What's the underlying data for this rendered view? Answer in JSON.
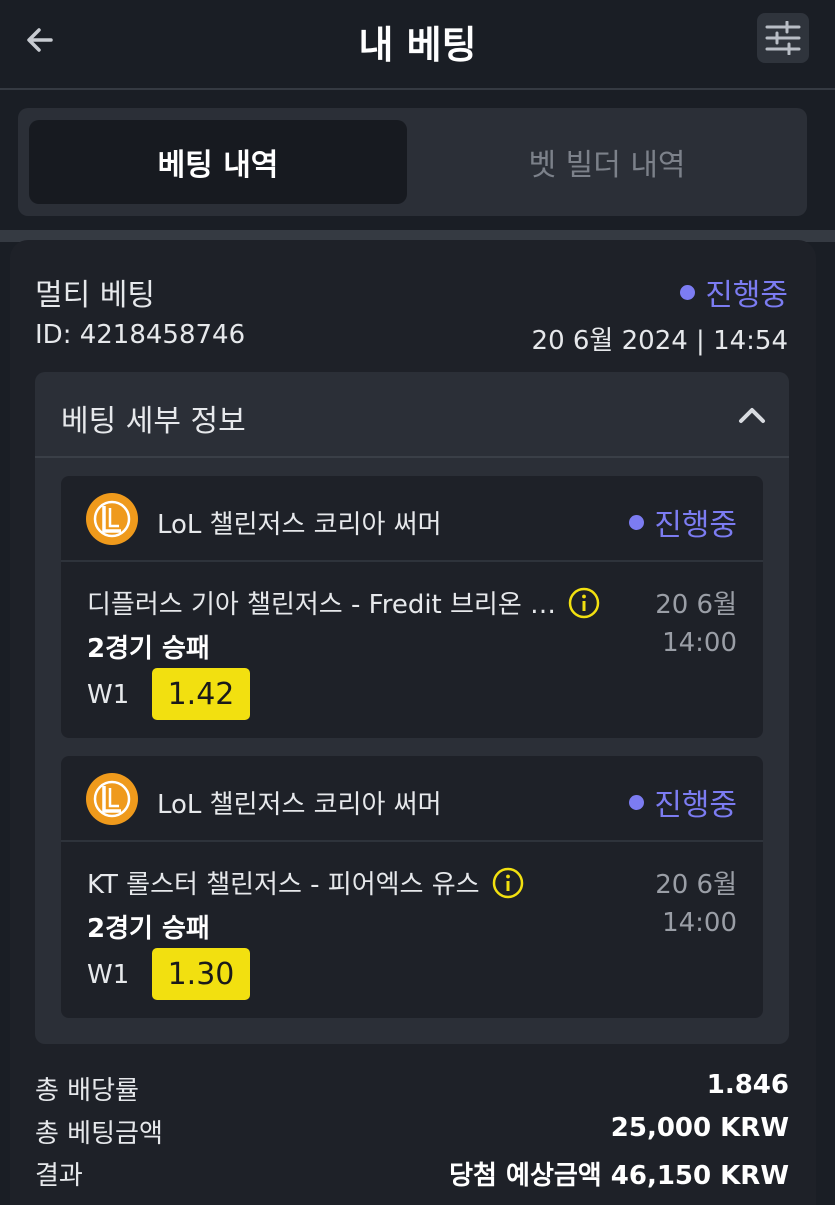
{
  "header": {
    "title": "내 베팅",
    "back_icon": "arrow-left-icon",
    "filter_icon": "sliders-icon"
  },
  "tabs": [
    {
      "label": "베팅 내역",
      "active": true
    },
    {
      "label": "벳 빌더 내역",
      "active": false
    }
  ],
  "bet_card": {
    "type": "멀티 베팅",
    "status": "진행중",
    "id": "ID: 4218458746",
    "datetime": "20 6월 2024 | 14:54",
    "details_title": "베팅 세부 정보",
    "selections": [
      {
        "league": "LoL 챌린저스 코리아 써머",
        "status": "진행중",
        "match": "디플러스 기아 챌린저스 - Fredit 브리온 …",
        "date": "20 6월",
        "time": "14:00",
        "market": "2경기 승패",
        "pick": "W1",
        "odds": "1.42"
      },
      {
        "league": "LoL 챌린저스 코리아 써머",
        "status": "진행중",
        "match": "KT 롤스터 챌린저스 - 피어엑스 유스",
        "date": "20 6월",
        "time": "14:00",
        "market": "2경기 승패",
        "pick": "W1",
        "odds": "1.30"
      }
    ],
    "summary": {
      "total_odds_label": "총 배당률",
      "total_odds": "1.846",
      "total_stake_label": "총 베팅금액",
      "total_stake": "25,000 KRW",
      "result_label": "결과",
      "result": "당첨 예상금액 46,150 KRW"
    }
  },
  "colors": {
    "background": "#1a1e25",
    "accent_status": "#7c7cf2",
    "odds_badge": "#f2e010",
    "logo_orange": "#ef9a1c"
  }
}
